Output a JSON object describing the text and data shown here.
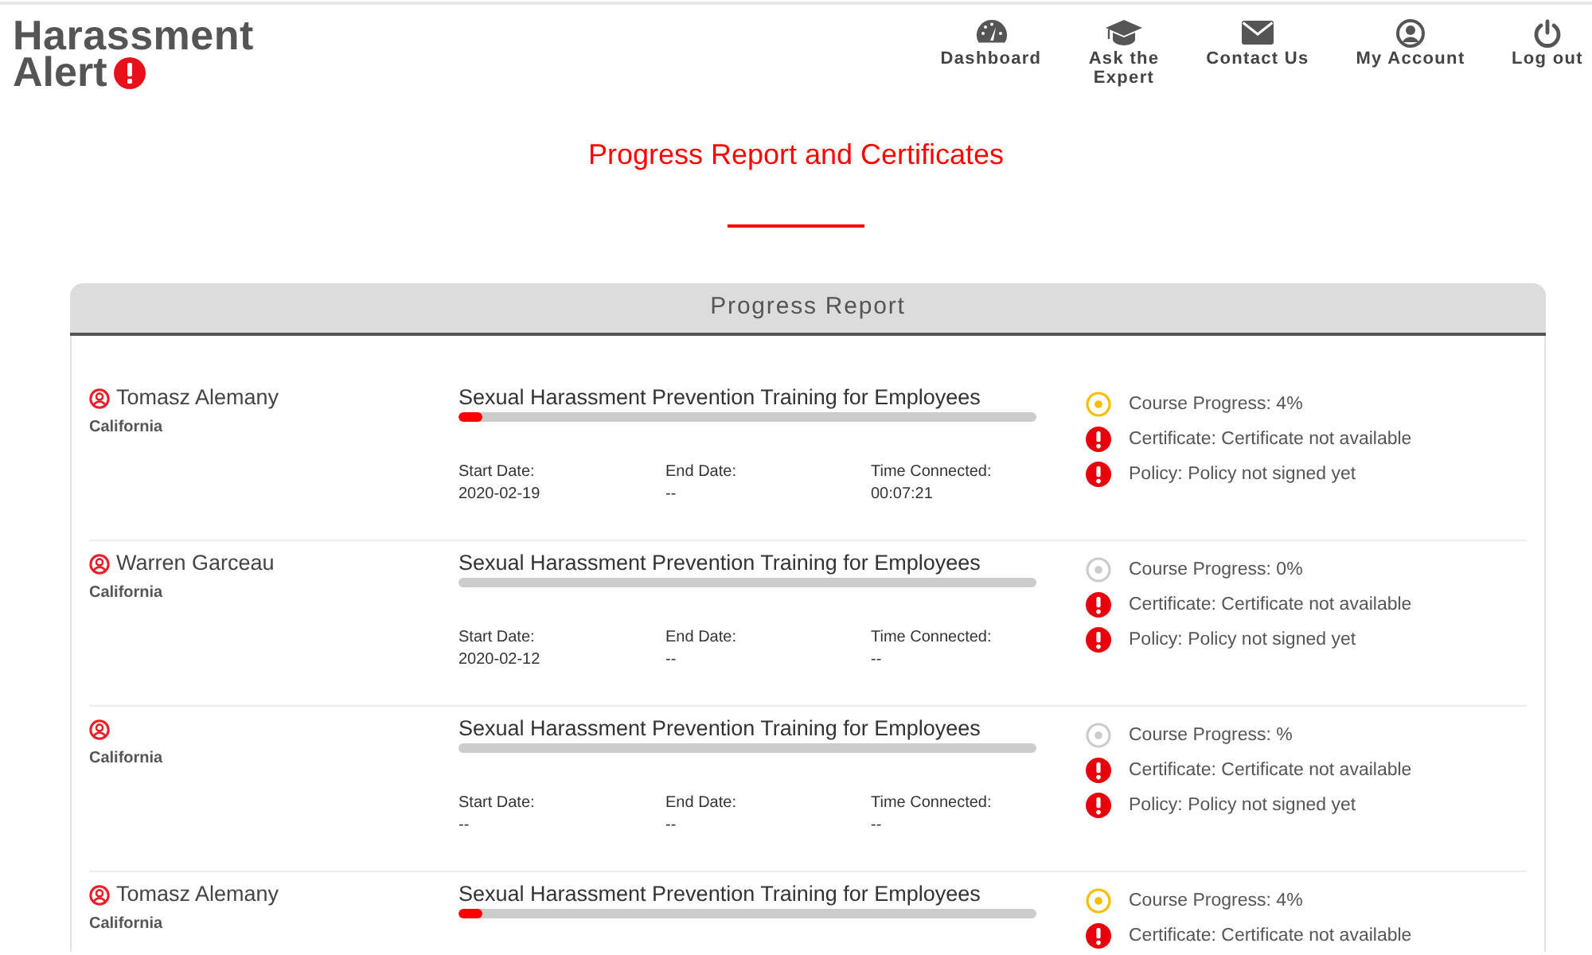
{
  "logo": {
    "lines": [
      "Harassment",
      "Alert"
    ]
  },
  "nav": [
    {
      "label": "Dashboard"
    },
    {
      "label": "Ask the Expert"
    },
    {
      "label": "Contact Us"
    },
    {
      "label": "My Account"
    },
    {
      "label": "Log out"
    }
  ],
  "page_title": "Progress Report and Certificates",
  "panel": {
    "title": "Progress Report",
    "rows": [
      {
        "name": "Tomasz Alemany",
        "state": "California",
        "course": "Sexual Harassment Prevention Training for Employees",
        "level": 0.04,
        "dates": [
          {
            "label": "Start Date:",
            "value": "2020-02-19"
          },
          {
            "label": "End Date:",
            "value": "--"
          },
          {
            "label": "Time Connected:",
            "value": "00:07:21"
          }
        ],
        "statuses": [
          {
            "kind": "ring",
            "color": "#f5bd00",
            "text": "Course Progress: 4%"
          },
          {
            "kind": "alert",
            "text": "Certificate: Certificate not available"
          },
          {
            "kind": "alert",
            "text": "Policy: Policy not signed yet"
          }
        ]
      },
      {
        "name": "Warren Garceau",
        "state": "California",
        "course": "Sexual Harassment Prevention Training for Employees",
        "level": 0,
        "dates": [
          {
            "label": "Start Date:",
            "value": "2020-02-12"
          },
          {
            "label": "End Date:",
            "value": "--"
          },
          {
            "label": "Time Connected:",
            "value": "--"
          }
        ],
        "statuses": [
          {
            "kind": "ring",
            "color": "#cccccc",
            "text": "Course Progress: 0%"
          },
          {
            "kind": "alert",
            "text": "Certificate: Certificate not available"
          },
          {
            "kind": "alert",
            "text": "Policy: Policy not signed yet"
          }
        ]
      },
      {
        "state": "California",
        "course": "Sexual Harassment Prevention Training for Employees",
        "level": 0,
        "dates": [
          {
            "label": "Start Date:",
            "value": "--"
          },
          {
            "label": "End Date:",
            "value": "--"
          },
          {
            "label": "Time Connected:",
            "value": "--"
          }
        ],
        "statuses": [
          {
            "kind": "ring",
            "color": "#cccccc",
            "text": "Course Progress: %"
          },
          {
            "kind": "alert",
            "text": "Certificate: Certificate not available"
          },
          {
            "kind": "alert",
            "text": "Policy: Policy not signed yet"
          }
        ]
      },
      {
        "name": "Tomasz Alemany",
        "state": "California",
        "course": "Sexual Harassment Prevention Training for Employees",
        "level": 0.04,
        "statuses": [
          {
            "kind": "ring",
            "color": "#f5bd00",
            "text": "Course Progress: 4%"
          },
          {
            "kind": "alert",
            "text": "Certificate: Certificate not available"
          }
        ]
      }
    ]
  }
}
